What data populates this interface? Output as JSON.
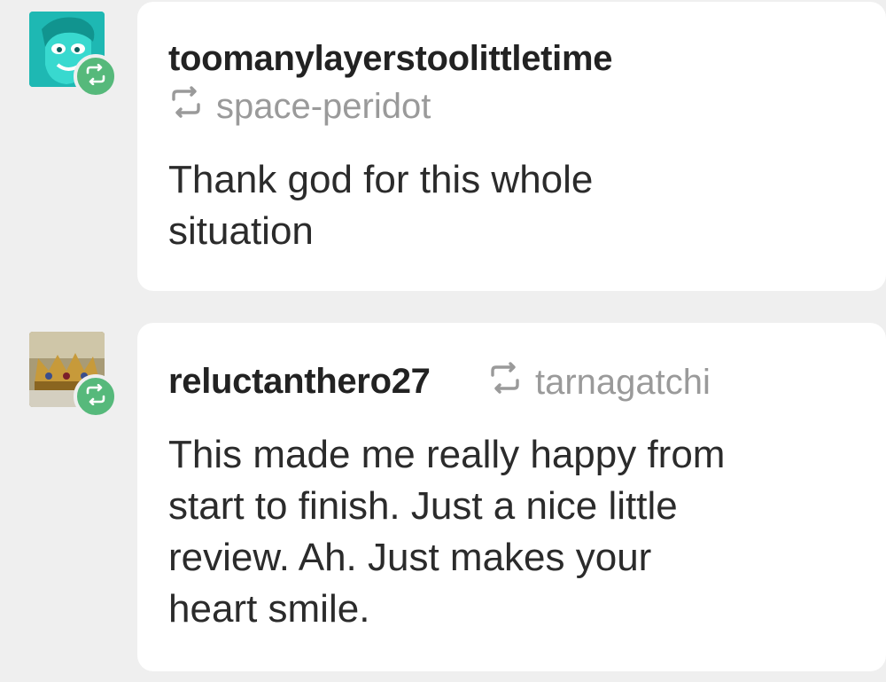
{
  "notes": [
    {
      "username": "toomanylayerstoolittletime",
      "reblog_source": "space-peridot",
      "text": "Thank god for this whole situation",
      "avatar": "cartoon-face-avatar",
      "badge_icon": "reblog-icon"
    },
    {
      "username": "reluctanthero27",
      "reblog_source": "tarnagatchi",
      "text": "This made me really happy from start to finish. Just a nice little review. Ah. Just makes your heart smile.",
      "avatar": "crown-photo-avatar",
      "badge_icon": "reblog-icon"
    }
  ],
  "colors": {
    "background": "#efefef",
    "card": "#ffffff",
    "badge": "#56b97b",
    "muted_text": "#9a9a9a",
    "username_text": "#222222"
  }
}
